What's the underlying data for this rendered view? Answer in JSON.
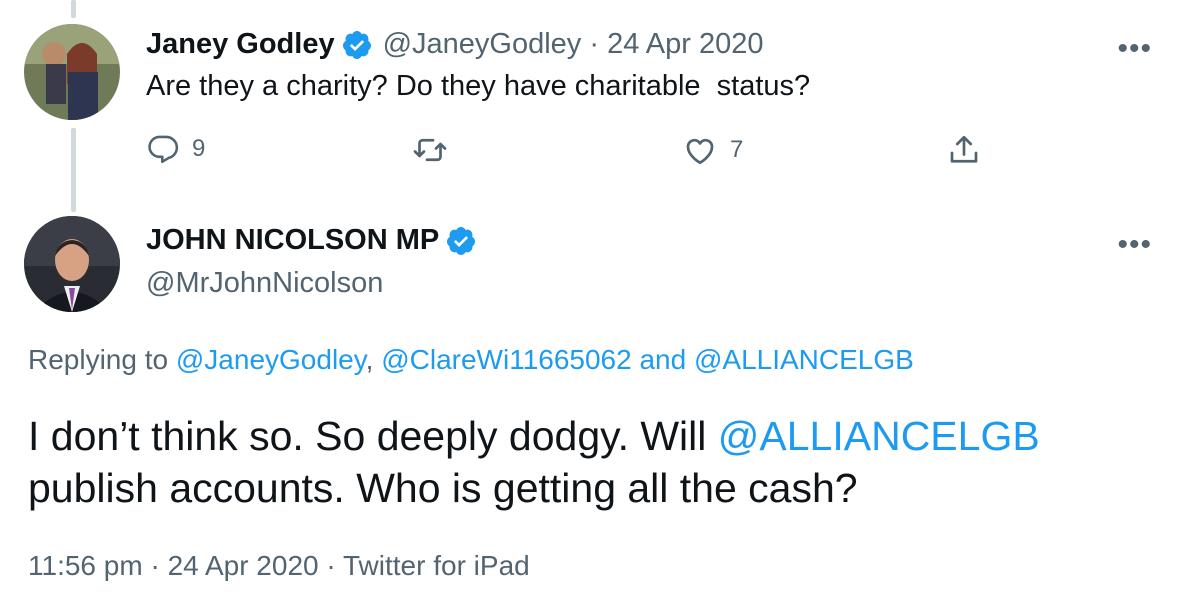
{
  "tweet1": {
    "display_name": "Janey Godley",
    "handle": "@JaneyGodley",
    "date_sep": " · ",
    "date": "24 Apr 2020",
    "text": "Are they a charity? Do they have charitable  status?",
    "more_label": "•••",
    "actions": {
      "reply_icon": "reply-icon",
      "reply_count": "9",
      "retweet_icon": "retweet-icon",
      "like_icon": "heart-icon",
      "like_count": "7",
      "share_icon": "share-icon"
    }
  },
  "tweet2": {
    "display_name": "JOHN NICOLSON MP",
    "handle": "@MrJohnNicolson",
    "more_label": "•••",
    "replying": {
      "prefix": "Replying to ",
      "mention1": "@JaneyGodley",
      "sep1": ", ",
      "mention2": "@ClareWi11665062",
      "sep2": " and ",
      "mention3": "@ALLIANCELGB"
    },
    "text": {
      "part1": "I don’t think so. So deeply dodgy. Will ",
      "mention": "@ALLIANCELGB",
      "part2": " publish accounts. Who is getting all the cash?"
    },
    "meta": {
      "time": "11:56 pm",
      "sep1": " · ",
      "date": "24 Apr 2020",
      "sep2": " · ",
      "source": "Twitter for iPad"
    }
  },
  "colors": {
    "verified": "#1d9bf0",
    "link": "#1d9bf0",
    "secondary_text": "#536471",
    "thread_line": "#cfd9de"
  }
}
